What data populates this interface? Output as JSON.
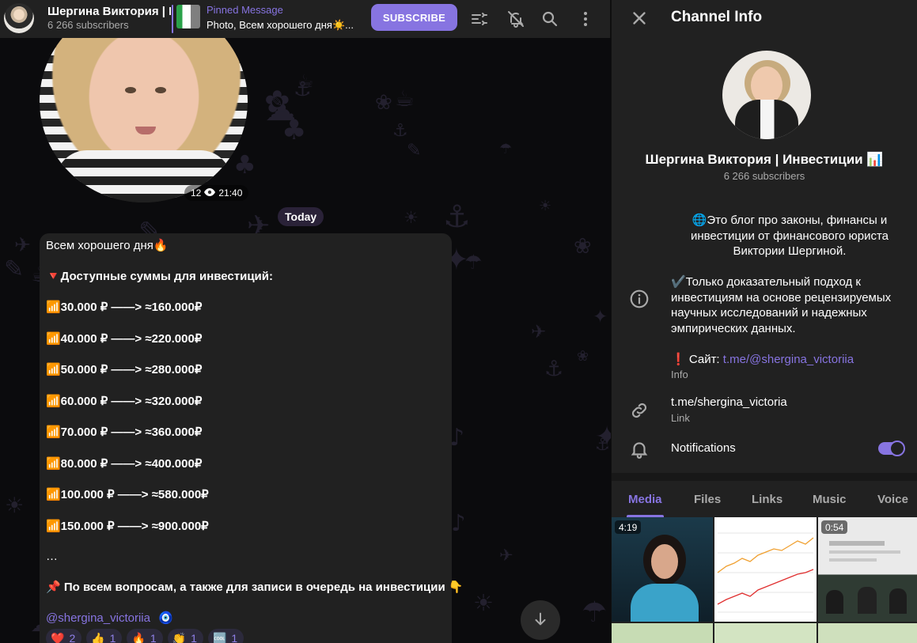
{
  "header": {
    "channel_name": "Шергина Виктория | Инвестиции 📊",
    "subscribers": "6 266 subscribers",
    "pinned_label": "Pinned Message",
    "pinned_text": "Photo, Всем хорошего дня☀️...",
    "subscribe_label": "SUBSCRIBE",
    "icons": [
      "topics-icon",
      "mute-icon",
      "search-icon",
      "more-icon"
    ]
  },
  "video_note": {
    "views": "12",
    "time": "21:40"
  },
  "date_chip": "Today",
  "message": {
    "greeting": "Всем хорошего дня🔥",
    "heading": "🔻Доступные суммы для инвестиций:",
    "amounts": [
      "📶30.000 ₽ ——> ≈160.000₽",
      "📶40.000 ₽ ——> ≈220.000₽",
      "📶50.000 ₽ ——> ≈280.000₽",
      "📶60.000 ₽ ——> ≈320.000₽",
      "📶70.000 ₽ ——> ≈360.000₽",
      "📶80.000 ₽ ——> ≈400.000₽",
      "📶100.000 ₽ ——> ≈580.000₽",
      "📶150.000 ₽ ——> ≈900.000₽"
    ],
    "ellipsis": "…",
    "contact_line": "📌 По всем вопросам, а также для записи в очередь на инвестиции 👇",
    "handle": "@shergina_victoriia",
    "handle_emoji": "🧿",
    "reactions": [
      {
        "emoji": "❤️",
        "count": "2"
      },
      {
        "emoji": "👍",
        "count": "1"
      },
      {
        "emoji": "🔥",
        "count": "1"
      },
      {
        "emoji": "👏",
        "count": "1"
      },
      {
        "emoji": "🆒",
        "count": "1"
      }
    ]
  },
  "panel": {
    "title": "Channel Info",
    "name": "Шергина Виктория | Инвестиции 📊",
    "subscribers": "6 266 subscribers",
    "info_para1": "🌐Это блог про законы, финансы и инвестиции от финансового юриста Виктории Шергиной.",
    "info_para2": "✔️Только доказательный подход к инвестициям на основе рецензируемых научных исследований и надежных эмпирических данных.",
    "info_site_prefix": "❗ Сайт: ",
    "info_site_link": "t.me/@shergina_victoriia",
    "info_caption": "Info",
    "link_value": "t.me/shergina_victoria",
    "link_caption": "Link",
    "notifications_label": "Notifications",
    "notifications_on": true,
    "tabs": [
      "Media",
      "Files",
      "Links",
      "Music",
      "Voice"
    ],
    "active_tab": "Media",
    "media": [
      {
        "duration": "4:19"
      },
      {
        "duration": ""
      },
      {
        "duration": "0:54"
      }
    ],
    "accent": "#8774e1"
  }
}
